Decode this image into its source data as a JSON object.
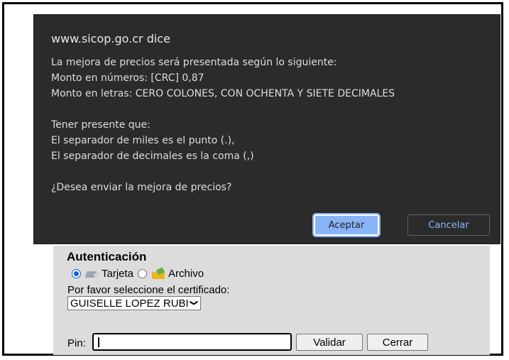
{
  "dialog": {
    "origin": "www.sicop.go.cr dice",
    "message": "La mejora de precios será presentada según lo siguiente:\nMonto en números: [CRC] 0,87\nMonto en letras: CERO COLONES, CON OCHENTA Y SIETE DECIMALES\n\nTener presente que:\nEl separador de miles es el punto (.),\nEl separador de decimales es la coma (,)\n\n¿Desea enviar la mejora de precios?",
    "ok_label": "Aceptar",
    "cancel_label": "Cancelar",
    "colors": {
      "background": "#2b2b2b",
      "accent": "#8ab4f8"
    }
  },
  "auth": {
    "title": "Autenticación",
    "options": [
      {
        "label": "Tarjeta",
        "icon": "card-reader-icon",
        "selected": true
      },
      {
        "label": "Archivo",
        "icon": "folder-icon",
        "selected": false
      }
    ],
    "cert_label": "Por favor seleccione el certificado:",
    "cert_selected": "GUISELLE LOPEZ RUBI",
    "pin_label": "Pin:",
    "pin_value": "",
    "validate_label": "Validar",
    "close_label": "Cerrar"
  }
}
